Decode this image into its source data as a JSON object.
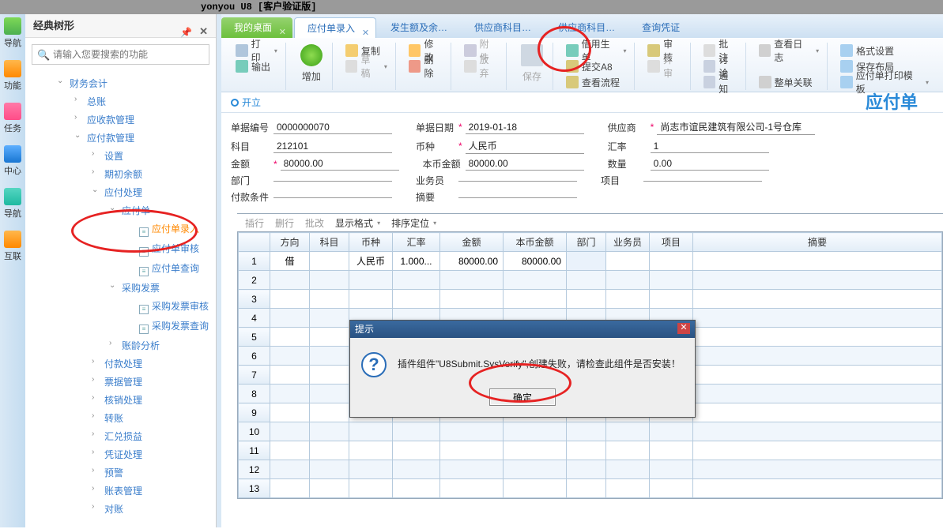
{
  "app_title": "yonyou U8 [客户验证版]",
  "tree": {
    "header": "经典树形",
    "search_placeholder": "请输入您要搜索的功能",
    "nodes": {
      "finance": "财务会计",
      "gl": "总账",
      "ar": "应收款管理",
      "ap": "应付款管理",
      "settings": "设置",
      "beginning": "期初余额",
      "ap_process": "应付处理",
      "payable_doc": "应付单",
      "payable_entry": "应付单录入",
      "payable_audit": "应付单审核",
      "payable_query": "应付单查询",
      "purchase_invoice": "采购发票",
      "pi_audit": "采购发票审核",
      "pi_query": "采购发票查询",
      "aging": "账龄分析",
      "payment": "付款处理",
      "bill": "票据管理",
      "cancel": "核销处理",
      "transfer": "转账",
      "exchange": "汇兑损益",
      "voucher": "凭证处理",
      "alert": "预警",
      "report": "账表管理",
      "recon": "对账"
    }
  },
  "rail": [
    "导航",
    "功能",
    "任务",
    "中心",
    "导航",
    "互联"
  ],
  "tabs": {
    "desktop": "我的桌面",
    "entry": "应付单录入",
    "balance": "发生额及余…",
    "vendor1": "供应商科目…",
    "vendor2": "供应商科目…",
    "vquery": "查询凭证"
  },
  "toolbar": {
    "print": "打印",
    "export": "输出",
    "add": "增加",
    "copy": "复制",
    "modify": "修改",
    "draft": "草稿",
    "delete": "删除",
    "attach": "附件",
    "discard": "放弃",
    "save": "保存",
    "borrow": "借用生单",
    "submit": "提交A8",
    "flow": "查看流程",
    "audit": "审核",
    "unaudit": "弃审",
    "batch": "批注",
    "discuss": "讨论",
    "notify": "通知",
    "log": "查看日志",
    "related": "整单关联",
    "format": "格式设置",
    "savelayout": "保存布局",
    "printtpl": "应付单打印模板"
  },
  "status": {
    "open": "开立",
    "doc_title": "应付单"
  },
  "form": {
    "docno_lbl": "单据编号",
    "docno": "0000000070",
    "date_lbl": "单据日期",
    "date": "2019-01-18",
    "vendor_lbl": "供应商",
    "vendor": "尚志市谊民建筑有限公司-1号仓库",
    "subject_lbl": "科目",
    "subject": "212101",
    "currency_lbl": "币种",
    "currency": "人民币",
    "rate_lbl": "汇率",
    "rate": "1",
    "amount_lbl": "金额",
    "amount": "80000.00",
    "localamt_lbl": "本币金额",
    "localamt": "80000.00",
    "qty_lbl": "数量",
    "qty": "0.00",
    "dept_lbl": "部门",
    "dept": "",
    "person_lbl": "业务员",
    "person": "",
    "project_lbl": "项目",
    "project": "",
    "paycond_lbl": "付款条件",
    "paycond": "",
    "memo_lbl": "摘要",
    "memo": ""
  },
  "grid": {
    "actions": {
      "ins": "插行",
      "del": "删行",
      "batch": "批改",
      "fmt": "显示格式",
      "sort": "排序定位"
    },
    "cols": [
      "方向",
      "科目",
      "币种",
      "汇率",
      "金额",
      "本币金额",
      "部门",
      "业务员",
      "项目",
      "摘要"
    ],
    "rows": [
      {
        "dir": "借",
        "subj": "",
        "cur": "人民币",
        "rate": "1.000...",
        "amt": "80000.00",
        "lamt": "80000.00"
      }
    ]
  },
  "dialog": {
    "title": "提示",
    "message": "插件组件\"U8Submit.SysVerify\",创建失败，请检查此组件是否安装！",
    "ok": "确定"
  }
}
